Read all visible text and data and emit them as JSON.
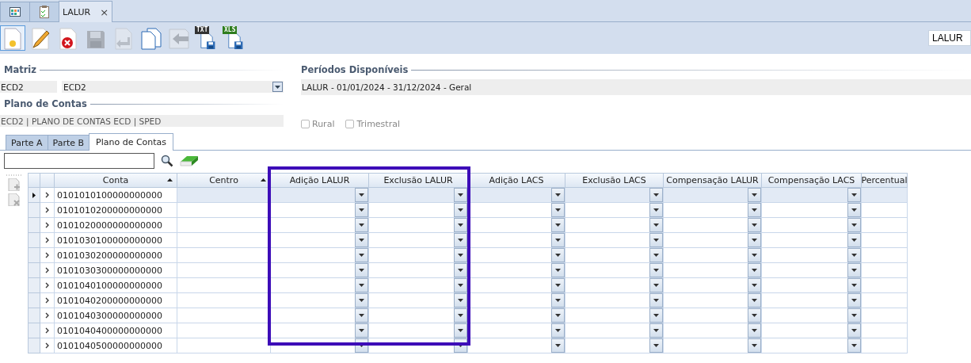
{
  "doc_tabs": [
    {
      "kind": "grid",
      "selected": false
    },
    {
      "kind": "clipboard",
      "selected": false
    },
    {
      "kind": "text",
      "label": "LALUR",
      "close": "×",
      "selected": true
    }
  ],
  "toolbar": [
    {
      "kind": "new",
      "selected": true,
      "disabled": false
    },
    {
      "kind": "edit",
      "selected": false,
      "disabled": false
    },
    {
      "kind": "delete",
      "selected": false,
      "disabled": false
    },
    {
      "kind": "save",
      "selected": false,
      "disabled": true
    },
    {
      "kind": "undo",
      "selected": false,
      "disabled": true
    },
    {
      "kind": "copy",
      "selected": false,
      "disabled": false
    },
    {
      "kind": "back",
      "selected": false,
      "disabled": true
    },
    {
      "kind": "export",
      "badge": "TXT",
      "color": "#333333",
      "selected": false,
      "disabled": false
    },
    {
      "kind": "export",
      "badge": "XLS",
      "color": "#2e7d1e",
      "selected": false,
      "disabled": false
    }
  ],
  "module_field": {
    "value": "LALUR"
  },
  "matriz": {
    "title": "Matriz",
    "code": "ECD2",
    "name": "ECD2"
  },
  "plano_de_contas": {
    "title": "Plano de Contas",
    "value": "ECD2 | PLANO DE CONTAS ECD | SPED"
  },
  "periodos": {
    "title": "Períodos Disponíveis",
    "items": [
      "LALUR - 01/01/2024 - 31/12/2024 - Geral"
    ]
  },
  "options": [
    {
      "label": "Rural",
      "checked": false,
      "disabled": true
    },
    {
      "label": "Trimestral",
      "checked": false,
      "disabled": true
    }
  ],
  "tabs": [
    {
      "label": "Parte A",
      "selected": false
    },
    {
      "label": "Parte B",
      "selected": false
    },
    {
      "label": "Plano de Contas",
      "selected": true
    }
  ],
  "table": {
    "columns": [
      {
        "label": "Conta",
        "kind": "text",
        "sorted": true,
        "highlighted": false
      },
      {
        "label": "Centro",
        "kind": "text",
        "sorted": true,
        "highlighted": false
      },
      {
        "label": "Adição LALUR",
        "kind": "dropdown",
        "sorted": false,
        "highlighted": true
      },
      {
        "label": "Exclusão LALUR",
        "kind": "dropdown",
        "sorted": false,
        "highlighted": true
      },
      {
        "label": "Adição LACS",
        "kind": "dropdown",
        "sorted": false,
        "highlighted": false
      },
      {
        "label": "Exclusão LACS",
        "kind": "dropdown",
        "sorted": false,
        "highlighted": false
      },
      {
        "label": "Compensação LALUR",
        "kind": "dropdown",
        "sorted": false,
        "highlighted": false
      },
      {
        "label": "Compensação LACS",
        "kind": "dropdown",
        "sorted": false,
        "highlighted": false
      },
      {
        "label": "Percentual",
        "kind": "text",
        "sorted": false,
        "highlighted": false
      }
    ],
    "rows": [
      {
        "conta": "0101010100000000000",
        "selected": true
      },
      {
        "conta": "0101010200000000000",
        "selected": false
      },
      {
        "conta": "0101020000000000000",
        "selected": false
      },
      {
        "conta": "0101030100000000000",
        "selected": false
      },
      {
        "conta": "0101030200000000000",
        "selected": false
      },
      {
        "conta": "0101030300000000000",
        "selected": false
      },
      {
        "conta": "0101040100000000000",
        "selected": false
      },
      {
        "conta": "0101040200000000000",
        "selected": false
      },
      {
        "conta": "0101040300000000000",
        "selected": false
      },
      {
        "conta": "0101040400000000000",
        "selected": false
      },
      {
        "conta": "0101040500000000000",
        "selected": false
      }
    ]
  }
}
